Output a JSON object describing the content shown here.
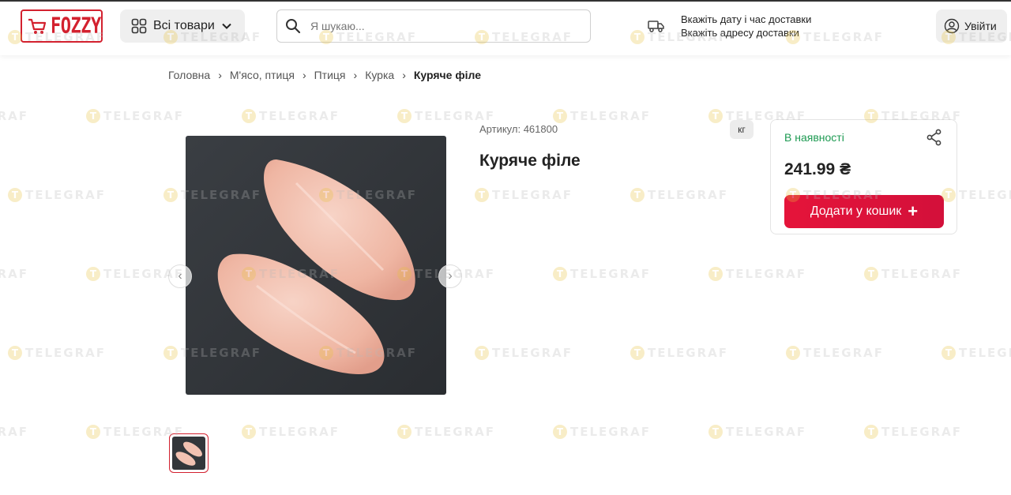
{
  "header": {
    "logo_text": "FOZZY",
    "catalog_label": "Всі товари",
    "search_placeholder": "Я шукаю...",
    "delivery_date": "Вкажіть дату і час доставки",
    "delivery_address": "Вкажіть адресу доставки",
    "login_label": "Увійти"
  },
  "breadcrumb": [
    "Головна",
    "М'ясо, птиця",
    "Птиця",
    "Курка",
    "Куряче філе"
  ],
  "product": {
    "sku": "Артикул: 461800",
    "title": "Куряче філе",
    "unit": "кг",
    "stock_status": "В наявності",
    "price": "241.99 ₴",
    "add_to_cart_label": "Додати у кошик"
  },
  "watermark": {
    "text": "TELEGRAF",
    "icon_letter": "T"
  },
  "colors": {
    "brand_red": "#d3212f",
    "button_red": "#e5143a",
    "in_stock_green": "#1d9a52",
    "watermark_yellow": "#e8c23a"
  }
}
